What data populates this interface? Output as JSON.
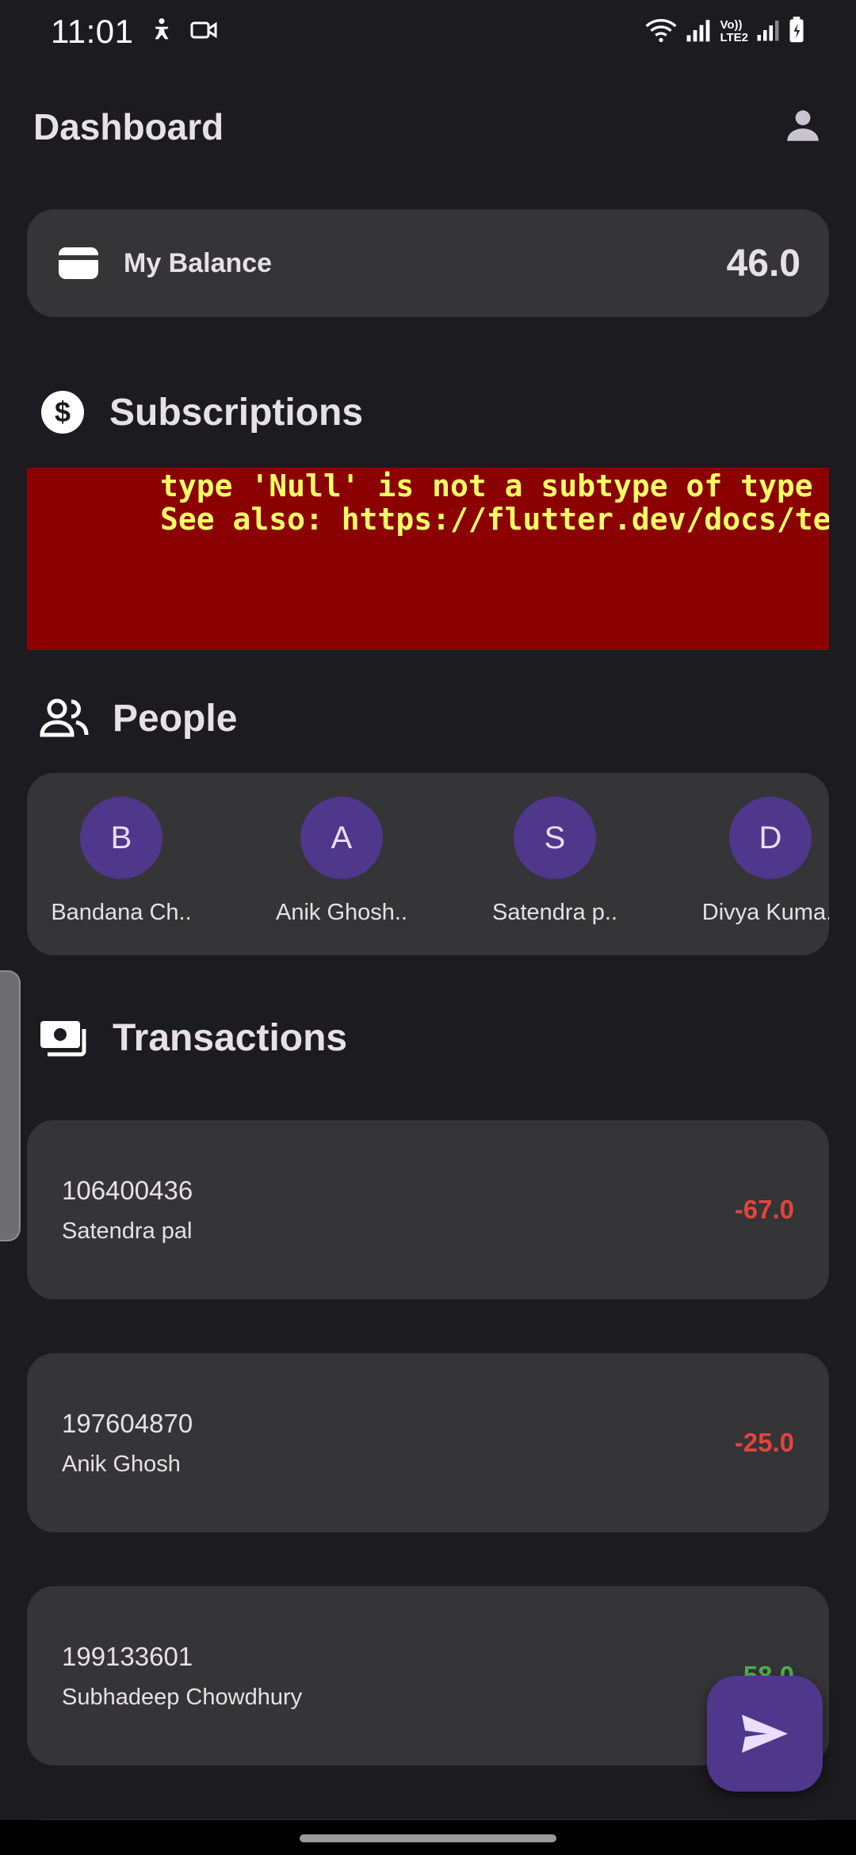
{
  "status_bar": {
    "time": "11:01",
    "network_label_top": "Vo))",
    "network_label_bottom": "LTE2"
  },
  "app_bar": {
    "title": "Dashboard",
    "profile_icon": "account-icon"
  },
  "balance": {
    "icon": "wallet-icon",
    "label": "My Balance",
    "value": "46.0"
  },
  "subscriptions": {
    "icon": "dollar-circle-icon",
    "title": "Subscriptions",
    "error_line_1": "type 'Null' is not a subtype of type 'S",
    "error_line_2": "See also: https://flutter.dev/docs/test"
  },
  "people": {
    "icon": "people-icon",
    "title": "People",
    "items": [
      {
        "initial": "B",
        "name": "Bandana Ch.."
      },
      {
        "initial": "A",
        "name": "Anik Ghosh.."
      },
      {
        "initial": "S",
        "name": "Satendra p.."
      },
      {
        "initial": "D",
        "name": "Divya Kuma.."
      }
    ]
  },
  "transactions": {
    "icon": "payments-icon",
    "title": "Transactions",
    "items": [
      {
        "id": "106400436",
        "name": "Satendra pal",
        "amount": "-67.0",
        "type": "debit"
      },
      {
        "id": "197604870",
        "name": "Anik Ghosh",
        "amount": "-25.0",
        "type": "debit"
      },
      {
        "id": "199133601",
        "name": "Subhadeep Chowdhury",
        "amount": "58.0",
        "type": "credit"
      }
    ]
  },
  "fab": {
    "icon": "send-icon"
  },
  "colors": {
    "background": "#1c1b1f",
    "card": "#353437",
    "avatar": "#4f378b",
    "error_bg": "#8b0000",
    "error_text": "#ffff66",
    "debit": "#e0463a",
    "credit": "#4caf50"
  }
}
